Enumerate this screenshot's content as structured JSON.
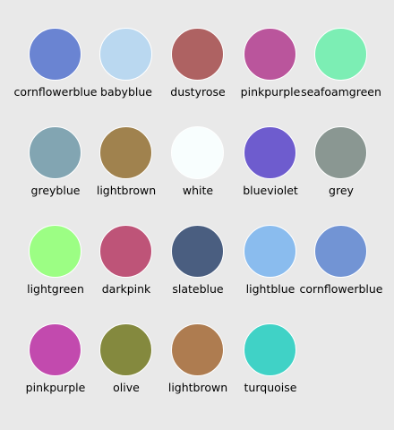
{
  "swatches": [
    {
      "name": "cornflowerblue",
      "color": "#6a84d2"
    },
    {
      "name": "babyblue",
      "color": "#bad8f0"
    },
    {
      "name": "dustyrose",
      "color": "#ae6262"
    },
    {
      "name": "pinkpurple",
      "color": "#ba559c"
    },
    {
      "name": "seafoamgreen",
      "color": "#7ceeb4"
    },
    {
      "name": "greyblue",
      "color": "#82a5b2"
    },
    {
      "name": "lightbrown",
      "color": "#a0824e"
    },
    {
      "name": "white",
      "color": "#f8fefe"
    },
    {
      "name": "blueviolet",
      "color": "#6e5cce"
    },
    {
      "name": "grey",
      "color": "#8a9792"
    },
    {
      "name": "lightgreen",
      "color": "#9cfe84"
    },
    {
      "name": "darkpink",
      "color": "#be5478"
    },
    {
      "name": "slateblue",
      "color": "#4a5e80"
    },
    {
      "name": "lightblue",
      "color": "#8abcee"
    },
    {
      "name": "cornflowerblue",
      "color": "#7294d4"
    },
    {
      "name": "pinkpurple",
      "color": "#c24aae"
    },
    {
      "name": "olive",
      "color": "#84893e"
    },
    {
      "name": "lightbrown",
      "color": "#ae7c50"
    },
    {
      "name": "turquoise",
      "color": "#40d2c6"
    }
  ]
}
